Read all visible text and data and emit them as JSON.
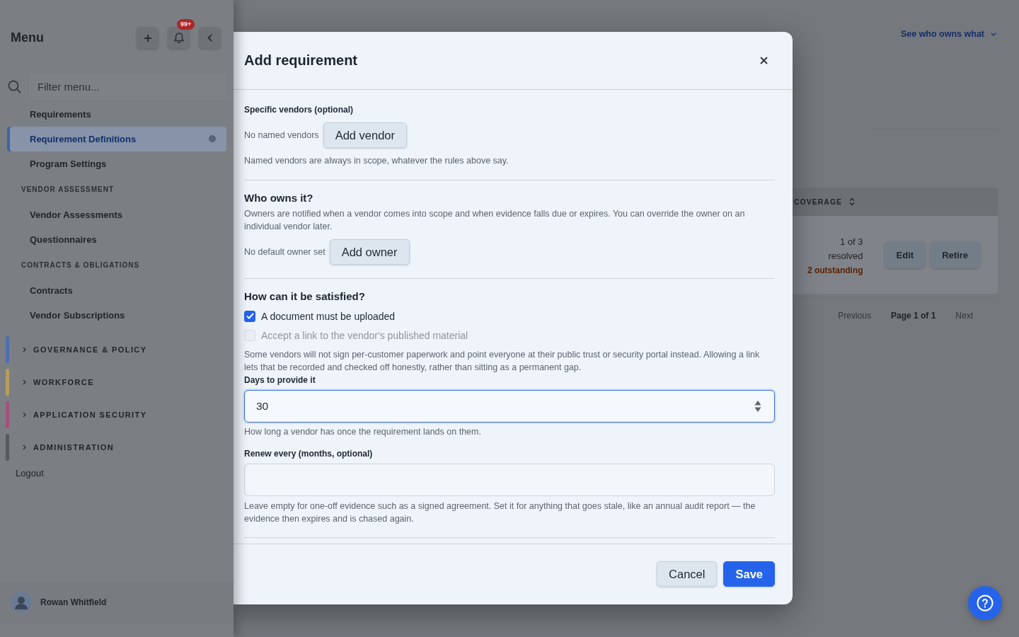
{
  "sidebar": {
    "title": "Menu",
    "badge": "99+",
    "filter_placeholder": "Filter menu...",
    "items": [
      {
        "kind": "link",
        "label": "Requirements",
        "selected": false
      },
      {
        "kind": "link",
        "label": "Requirement Definitions",
        "selected": true
      },
      {
        "kind": "link",
        "label": "Program Settings",
        "selected": false
      },
      {
        "kind": "heading",
        "label": "VENDOR ASSESSMENT"
      },
      {
        "kind": "link",
        "label": "Vendor Assessments",
        "selected": false
      },
      {
        "kind": "link",
        "label": "Questionnaires",
        "selected": false
      },
      {
        "kind": "heading",
        "label": "CONTRACTS & OBLIGATIONS"
      },
      {
        "kind": "link",
        "label": "Contracts",
        "selected": false
      },
      {
        "kind": "link",
        "label": "Vendor Subscriptions",
        "selected": false
      }
    ],
    "groups": [
      {
        "label": "GOVERNANCE & POLICY",
        "color": "#4f6db0",
        "expanded": false
      },
      {
        "label": "WORKFORCE",
        "color": "#b89c5a",
        "expanded": false
      },
      {
        "label": "APPLICATION SECURITY",
        "color": "#a4507a",
        "expanded": false
      },
      {
        "label": "ADMINISTRATION",
        "color": "#555a61",
        "expanded": false
      }
    ],
    "logout": "Logout",
    "user": {
      "name": "Rowan Whitfield"
    }
  },
  "page": {
    "link": "See who owns what",
    "table": {
      "columns": [
        "COVERAGE"
      ],
      "rows": [
        {
          "coverage": "1 of 3 resolved",
          "outstanding": "2 outstanding",
          "actions": [
            "Edit",
            "Retire"
          ]
        }
      ]
    },
    "pagination": {
      "previous": {
        "label": "Previous",
        "disabled": true
      },
      "page": "Page 1 of 1",
      "next": {
        "label": "Next",
        "disabled": true
      }
    }
  },
  "dialog": {
    "title": "Add requirement",
    "vendors": {
      "label": "Specific vendors (optional)",
      "empty_text": "No named vendors",
      "button": "Add vendor",
      "help": "Named vendors are always in scope, whatever the rules above say."
    },
    "owner": {
      "heading": "Who owns it?",
      "description": "Owners are notified when a vendor comes into scope and when evidence falls due or expires. You can override the owner on an individual vendor later.",
      "empty_text": "No default owner set",
      "button": "Add owner"
    },
    "satisfaction": {
      "heading": "How can it be satisfied?",
      "options": [
        {
          "label": "A document must be uploaded",
          "checked": true,
          "disabled": false
        },
        {
          "label": "Accept a link to the vendor's published material",
          "checked": false,
          "disabled": true
        }
      ],
      "description": "Some vendors will not sign per-customer paperwork and point everyone at their public trust or security portal instead. Allowing a link lets that be recorded and checked off honestly, rather than sitting as a permanent gap."
    },
    "fields": [
      {
        "label": "Days to provide it",
        "kind": "stepper",
        "value": "30",
        "focused": true,
        "help": "How long a vendor has once the requirement lands on them."
      },
      {
        "label": "Renew every (months, optional)",
        "kind": "plain",
        "focused": false,
        "help": "Leave empty for one-off evidence such as a signed agreement. Set it for anything that goes stale, like an annual audit report — the evidence then expires and is chased again."
      }
    ],
    "buttons": [
      {
        "label": "Cancel",
        "kind": "secondary"
      },
      {
        "label": "Save",
        "kind": "primary"
      }
    ]
  }
}
